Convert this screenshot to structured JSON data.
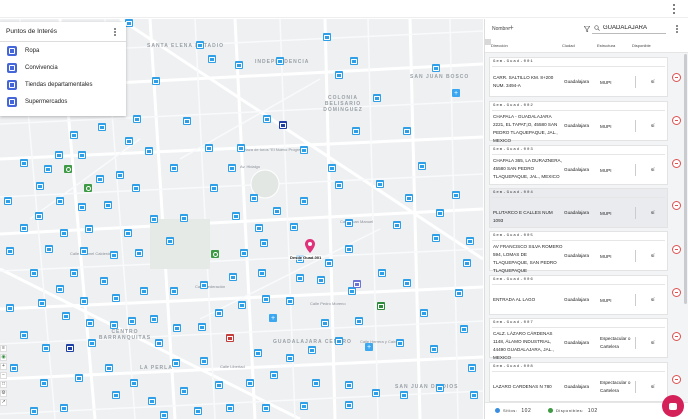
{
  "poi_panel": {
    "title": "Puntos de Interés",
    "items": [
      {
        "label": "Ropa",
        "icon": "clothing-icon"
      },
      {
        "label": "Convivencia",
        "icon": "social-icon"
      },
      {
        "label": "Tiendas departamentales",
        "icon": "department-store-icon"
      },
      {
        "label": "Supermercados",
        "icon": "supermarket-icon"
      }
    ]
  },
  "map": {
    "pin_label": "Desde Guad-001",
    "districts": [
      "SANTA ELENA ESTADIO",
      "INDEPENDENCIA",
      "SAN JUAN BOSCO",
      "COLONIA BELISARIO DOMINGUEZ",
      "CENTRO BARRANQUITAS",
      "LA PERLA",
      "GUADALAJARA CENTRO",
      "SAN JUAN DE DIOS"
    ],
    "streets": [
      "Calle Federación",
      "Calle Pedro Moreno",
      "Calle Herrera y Cairo",
      "Av. Hidalgo",
      "Calle Coronel Calderón",
      "Plaza de toros \"El Nuevo Progreso\"",
      "Calle Libertad",
      "Calle Juan Manuel"
    ],
    "controls": [
      "layers-icon",
      "location-icon",
      "zoom-in-icon",
      "zoom-out-icon",
      "fullscreen-icon",
      "settings-icon",
      "ruler-icon"
    ]
  },
  "panel": {
    "header_title": "Nombre",
    "search_value": "GUADALAJARA",
    "columns": [
      "Dirección",
      "Ciudad",
      "Estructura",
      "Disponible"
    ],
    "records": [
      {
        "code": "Gem-Guad-001",
        "address": "CARR. SALTILLO KM. 8+200 NUM. 3494-A",
        "city": "Guadalajara",
        "structure": "MUPI",
        "available": "sí"
      },
      {
        "code": "Gem-Guad-002",
        "address": "CHAPALA - GUADALAJARA 2221, EL TAPAT¡O, 45580 SAN PEDRO TLAQUEPAQUE, JAL., MEXICO",
        "city": "Guadalajara",
        "structure": "MUPI",
        "available": "sí"
      },
      {
        "code": "Gem-Guad-003",
        "address": "CHAPALA 365, LA DURAZNERA, 45580 SAN PEDRO TLAQUEPAQUE, JAL., MEXICO",
        "city": "Guadalajara",
        "structure": "MUPI",
        "available": "sí"
      },
      {
        "code": "Gem-Guad-004",
        "address": "PLUTARCO E CALLES NUM 1093",
        "city": "Guadalajara",
        "structure": "MUPI",
        "available": "sí"
      },
      {
        "code": "Gem-Guad-005",
        "address": "AV FRANCISCO SILVA ROMERO 594, LOMAS DE TLAQUEPAQUE, SAN PEDRO TLAQUEPAQUE",
        "city": "Guadalajara",
        "structure": "MUPI",
        "available": "sí"
      },
      {
        "code": "Gem-Guad-006",
        "address": "ENTRADA AL LAGO",
        "city": "Guadalajara",
        "structure": "MUPI",
        "available": "sí"
      },
      {
        "code": "Gem-Guad-007",
        "address": "CALZ. LÁZARO CÁRDENAS 1148, ÁLAMO INDUSTRIAL, 44490 GUADALAJARA, JAL., MEXICO",
        "city": "Guadalajara",
        "structure": "Espectacular o Cartelera",
        "available": "sí"
      },
      {
        "code": "Gem-Guad-008",
        "address": "LAZARO CARDENAS N 780",
        "city": "Guadalajara",
        "structure": "Espectacular o Cartelera",
        "available": "sí"
      }
    ],
    "footer": {
      "sites_label": "Sitios:",
      "sites_count": "102",
      "available_label": "Disponibles:",
      "available_count": "102"
    }
  },
  "colors": {
    "marker_blue": "#2f9fe8",
    "marker_green": "#3e9a45",
    "marker_red": "#c43d3d",
    "marker_navy": "#1e3fa6",
    "pin": "#e0317a",
    "delete": "#e05050"
  }
}
